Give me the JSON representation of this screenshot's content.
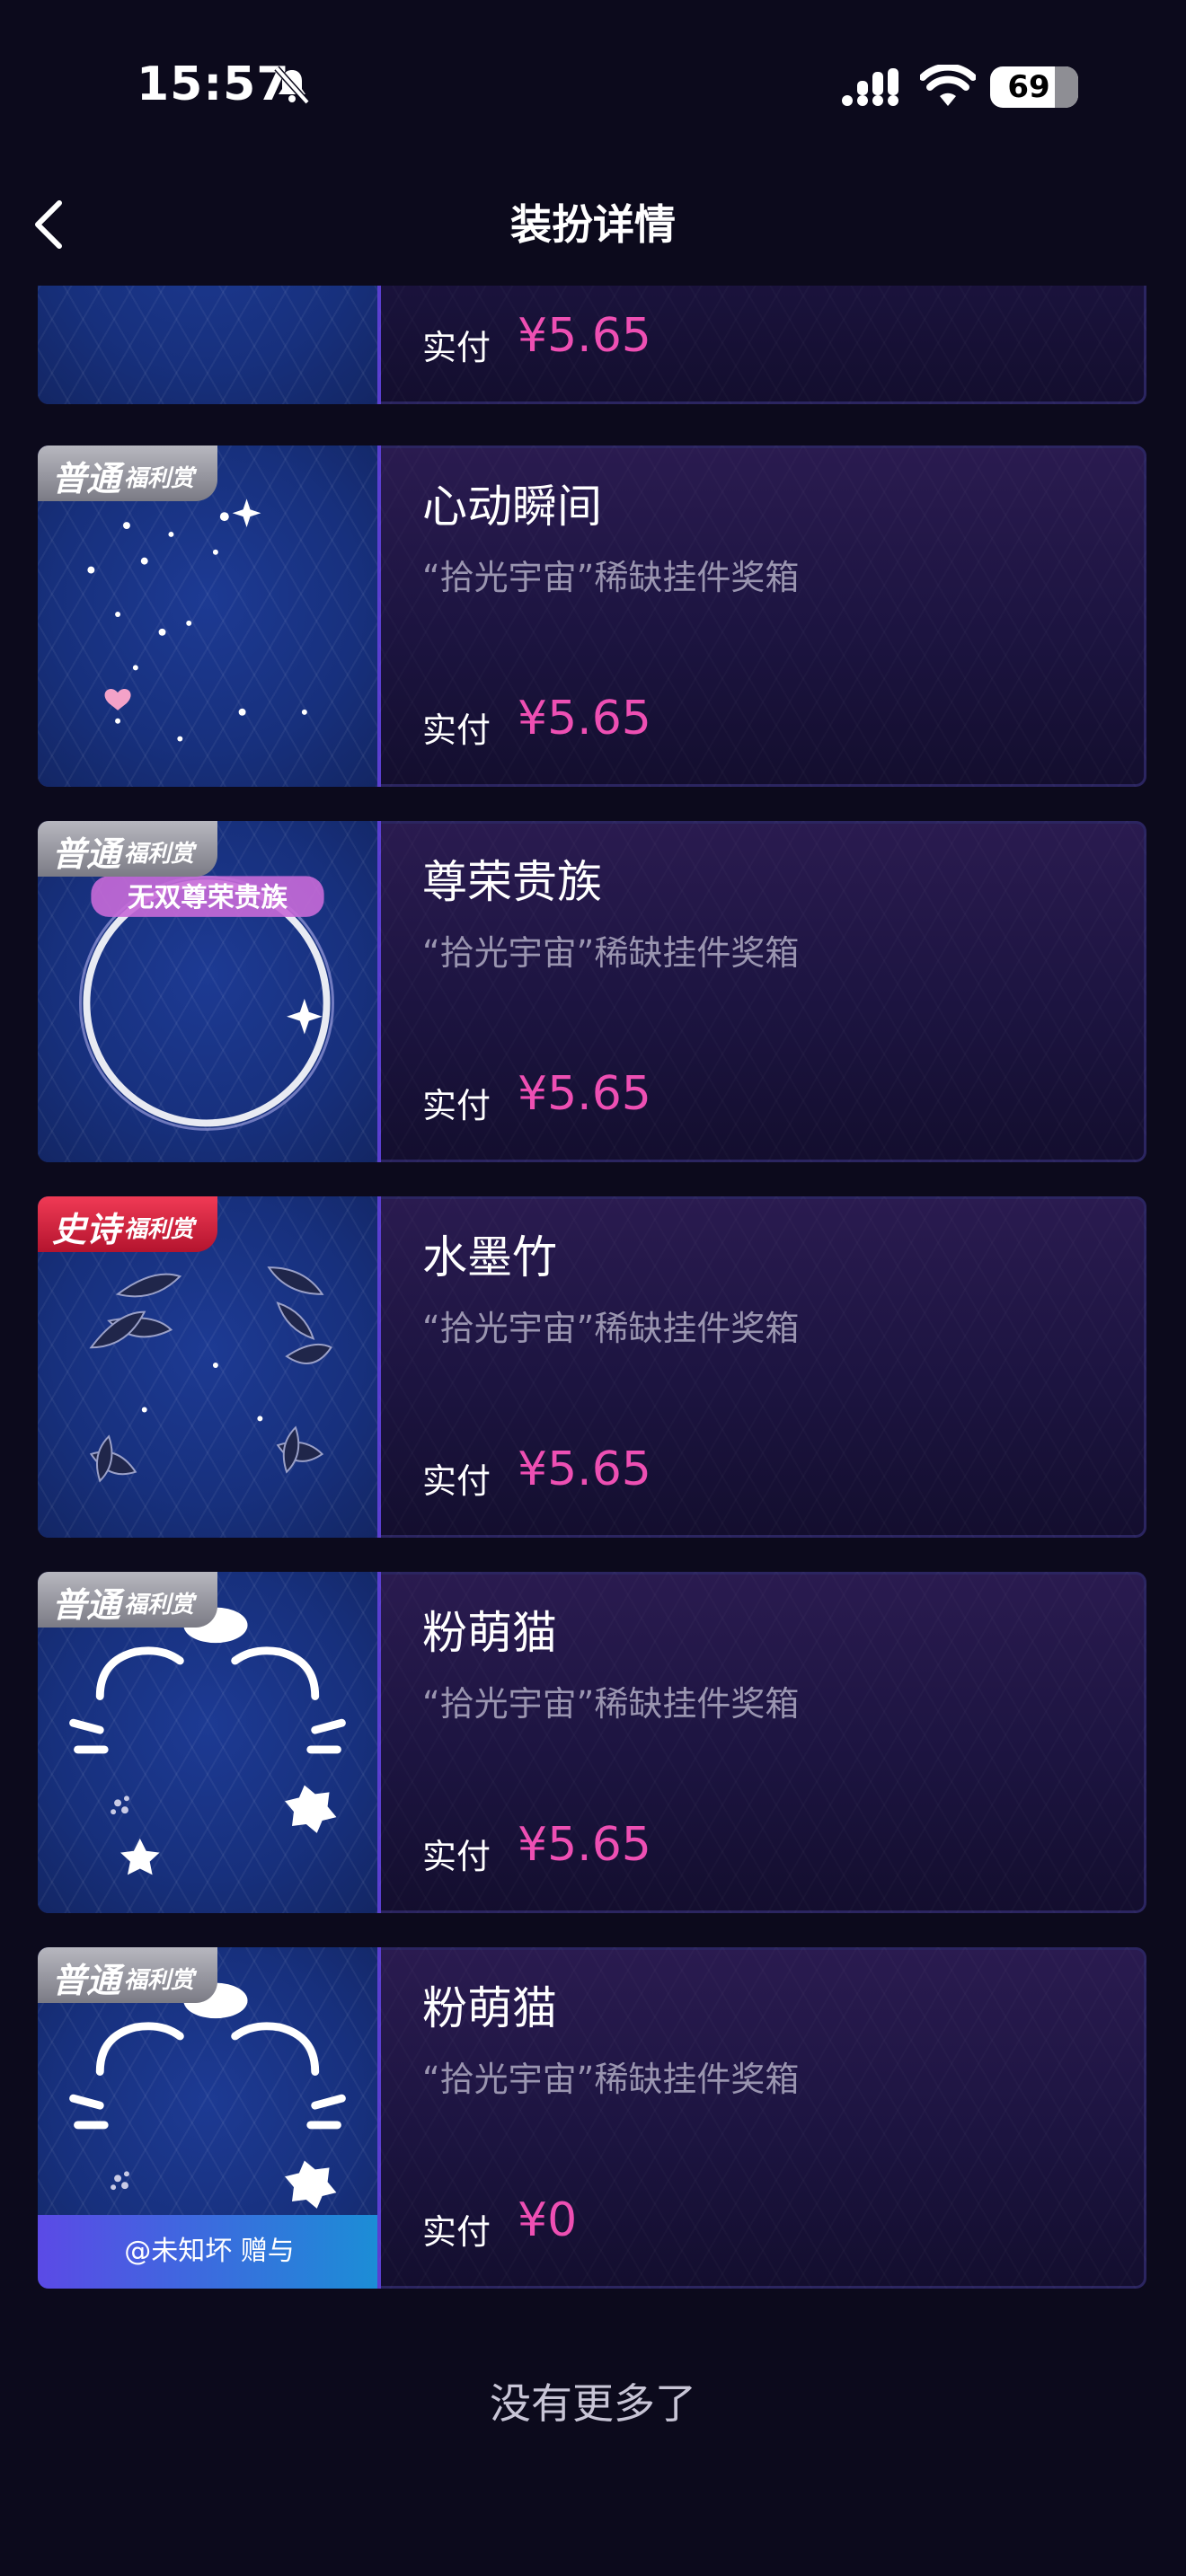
{
  "status_bar": {
    "time": "15:57",
    "battery": "69"
  },
  "nav": {
    "title": "装扮详情"
  },
  "items": [
    {
      "pay_label": "实付",
      "price": "¥5.65"
    },
    {
      "badge_main": "普通",
      "badge_sub": "福利赏",
      "name": "心动瞬间",
      "desc": "“拾光宇宙”稀缺挂件奖箱",
      "pay_label": "实付",
      "price": "¥5.65"
    },
    {
      "badge_main": "普通",
      "badge_sub": "福利赏",
      "name": "尊荣贵族",
      "desc": "“拾光宇宙”稀缺挂件奖箱",
      "pay_label": "实付",
      "price": "¥5.65",
      "art_text": "无双尊荣贵族"
    },
    {
      "badge_main": "史诗",
      "badge_sub": "福利赏",
      "name": "水墨竹",
      "desc": "“拾光宇宙”稀缺挂件奖箱",
      "pay_label": "实付",
      "price": "¥5.65"
    },
    {
      "badge_main": "普通",
      "badge_sub": "福利赏",
      "name": "粉萌猫",
      "desc": "“拾光宇宙”稀缺挂件奖箱",
      "pay_label": "实付",
      "price": "¥5.65"
    },
    {
      "badge_main": "普通",
      "badge_sub": "福利赏",
      "name": "粉萌猫",
      "desc": "“拾光宇宙”稀缺挂件奖箱",
      "pay_label": "实付",
      "price": "¥0",
      "gift_text": "@未知坏 赠与"
    }
  ],
  "footer": {
    "no_more": "没有更多了"
  },
  "colors": {
    "price": "#ee4fb3",
    "badge_common": "#9a9aa3",
    "badge_epic": "#e02a45",
    "background": "#0c0a1c"
  }
}
